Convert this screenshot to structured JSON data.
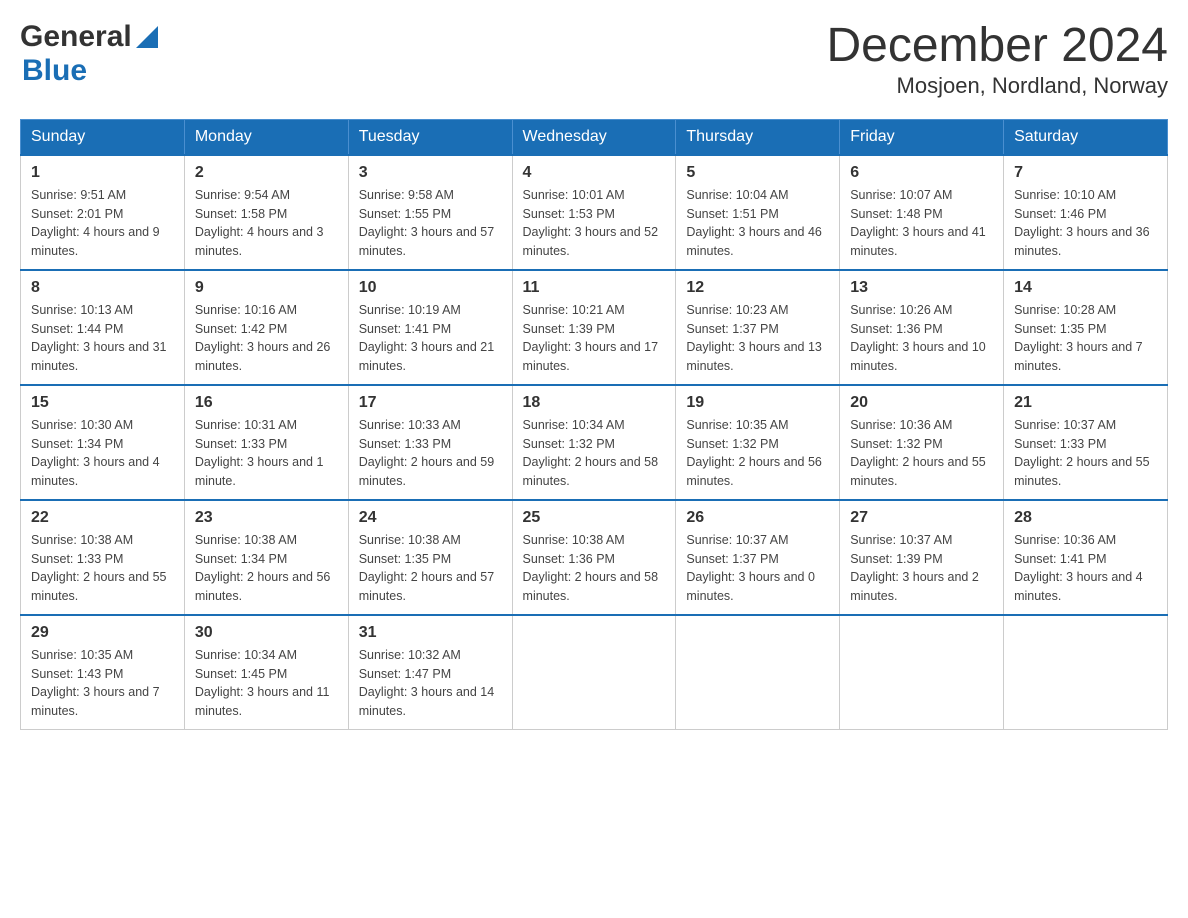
{
  "header": {
    "logo_general": "General",
    "logo_blue": "Blue",
    "month_title": "December 2024",
    "location": "Mosjoen, Nordland, Norway"
  },
  "days_of_week": [
    "Sunday",
    "Monday",
    "Tuesday",
    "Wednesday",
    "Thursday",
    "Friday",
    "Saturday"
  ],
  "weeks": [
    [
      {
        "day": "1",
        "sunrise": "Sunrise: 9:51 AM",
        "sunset": "Sunset: 2:01 PM",
        "daylight": "Daylight: 4 hours and 9 minutes."
      },
      {
        "day": "2",
        "sunrise": "Sunrise: 9:54 AM",
        "sunset": "Sunset: 1:58 PM",
        "daylight": "Daylight: 4 hours and 3 minutes."
      },
      {
        "day": "3",
        "sunrise": "Sunrise: 9:58 AM",
        "sunset": "Sunset: 1:55 PM",
        "daylight": "Daylight: 3 hours and 57 minutes."
      },
      {
        "day": "4",
        "sunrise": "Sunrise: 10:01 AM",
        "sunset": "Sunset: 1:53 PM",
        "daylight": "Daylight: 3 hours and 52 minutes."
      },
      {
        "day": "5",
        "sunrise": "Sunrise: 10:04 AM",
        "sunset": "Sunset: 1:51 PM",
        "daylight": "Daylight: 3 hours and 46 minutes."
      },
      {
        "day": "6",
        "sunrise": "Sunrise: 10:07 AM",
        "sunset": "Sunset: 1:48 PM",
        "daylight": "Daylight: 3 hours and 41 minutes."
      },
      {
        "day": "7",
        "sunrise": "Sunrise: 10:10 AM",
        "sunset": "Sunset: 1:46 PM",
        "daylight": "Daylight: 3 hours and 36 minutes."
      }
    ],
    [
      {
        "day": "8",
        "sunrise": "Sunrise: 10:13 AM",
        "sunset": "Sunset: 1:44 PM",
        "daylight": "Daylight: 3 hours and 31 minutes."
      },
      {
        "day": "9",
        "sunrise": "Sunrise: 10:16 AM",
        "sunset": "Sunset: 1:42 PM",
        "daylight": "Daylight: 3 hours and 26 minutes."
      },
      {
        "day": "10",
        "sunrise": "Sunrise: 10:19 AM",
        "sunset": "Sunset: 1:41 PM",
        "daylight": "Daylight: 3 hours and 21 minutes."
      },
      {
        "day": "11",
        "sunrise": "Sunrise: 10:21 AM",
        "sunset": "Sunset: 1:39 PM",
        "daylight": "Daylight: 3 hours and 17 minutes."
      },
      {
        "day": "12",
        "sunrise": "Sunrise: 10:23 AM",
        "sunset": "Sunset: 1:37 PM",
        "daylight": "Daylight: 3 hours and 13 minutes."
      },
      {
        "day": "13",
        "sunrise": "Sunrise: 10:26 AM",
        "sunset": "Sunset: 1:36 PM",
        "daylight": "Daylight: 3 hours and 10 minutes."
      },
      {
        "day": "14",
        "sunrise": "Sunrise: 10:28 AM",
        "sunset": "Sunset: 1:35 PM",
        "daylight": "Daylight: 3 hours and 7 minutes."
      }
    ],
    [
      {
        "day": "15",
        "sunrise": "Sunrise: 10:30 AM",
        "sunset": "Sunset: 1:34 PM",
        "daylight": "Daylight: 3 hours and 4 minutes."
      },
      {
        "day": "16",
        "sunrise": "Sunrise: 10:31 AM",
        "sunset": "Sunset: 1:33 PM",
        "daylight": "Daylight: 3 hours and 1 minute."
      },
      {
        "day": "17",
        "sunrise": "Sunrise: 10:33 AM",
        "sunset": "Sunset: 1:33 PM",
        "daylight": "Daylight: 2 hours and 59 minutes."
      },
      {
        "day": "18",
        "sunrise": "Sunrise: 10:34 AM",
        "sunset": "Sunset: 1:32 PM",
        "daylight": "Daylight: 2 hours and 58 minutes."
      },
      {
        "day": "19",
        "sunrise": "Sunrise: 10:35 AM",
        "sunset": "Sunset: 1:32 PM",
        "daylight": "Daylight: 2 hours and 56 minutes."
      },
      {
        "day": "20",
        "sunrise": "Sunrise: 10:36 AM",
        "sunset": "Sunset: 1:32 PM",
        "daylight": "Daylight: 2 hours and 55 minutes."
      },
      {
        "day": "21",
        "sunrise": "Sunrise: 10:37 AM",
        "sunset": "Sunset: 1:33 PM",
        "daylight": "Daylight: 2 hours and 55 minutes."
      }
    ],
    [
      {
        "day": "22",
        "sunrise": "Sunrise: 10:38 AM",
        "sunset": "Sunset: 1:33 PM",
        "daylight": "Daylight: 2 hours and 55 minutes."
      },
      {
        "day": "23",
        "sunrise": "Sunrise: 10:38 AM",
        "sunset": "Sunset: 1:34 PM",
        "daylight": "Daylight: 2 hours and 56 minutes."
      },
      {
        "day": "24",
        "sunrise": "Sunrise: 10:38 AM",
        "sunset": "Sunset: 1:35 PM",
        "daylight": "Daylight: 2 hours and 57 minutes."
      },
      {
        "day": "25",
        "sunrise": "Sunrise: 10:38 AM",
        "sunset": "Sunset: 1:36 PM",
        "daylight": "Daylight: 2 hours and 58 minutes."
      },
      {
        "day": "26",
        "sunrise": "Sunrise: 10:37 AM",
        "sunset": "Sunset: 1:37 PM",
        "daylight": "Daylight: 3 hours and 0 minutes."
      },
      {
        "day": "27",
        "sunrise": "Sunrise: 10:37 AM",
        "sunset": "Sunset: 1:39 PM",
        "daylight": "Daylight: 3 hours and 2 minutes."
      },
      {
        "day": "28",
        "sunrise": "Sunrise: 10:36 AM",
        "sunset": "Sunset: 1:41 PM",
        "daylight": "Daylight: 3 hours and 4 minutes."
      }
    ],
    [
      {
        "day": "29",
        "sunrise": "Sunrise: 10:35 AM",
        "sunset": "Sunset: 1:43 PM",
        "daylight": "Daylight: 3 hours and 7 minutes."
      },
      {
        "day": "30",
        "sunrise": "Sunrise: 10:34 AM",
        "sunset": "Sunset: 1:45 PM",
        "daylight": "Daylight: 3 hours and 11 minutes."
      },
      {
        "day": "31",
        "sunrise": "Sunrise: 10:32 AM",
        "sunset": "Sunset: 1:47 PM",
        "daylight": "Daylight: 3 hours and 14 minutes."
      },
      null,
      null,
      null,
      null
    ]
  ]
}
